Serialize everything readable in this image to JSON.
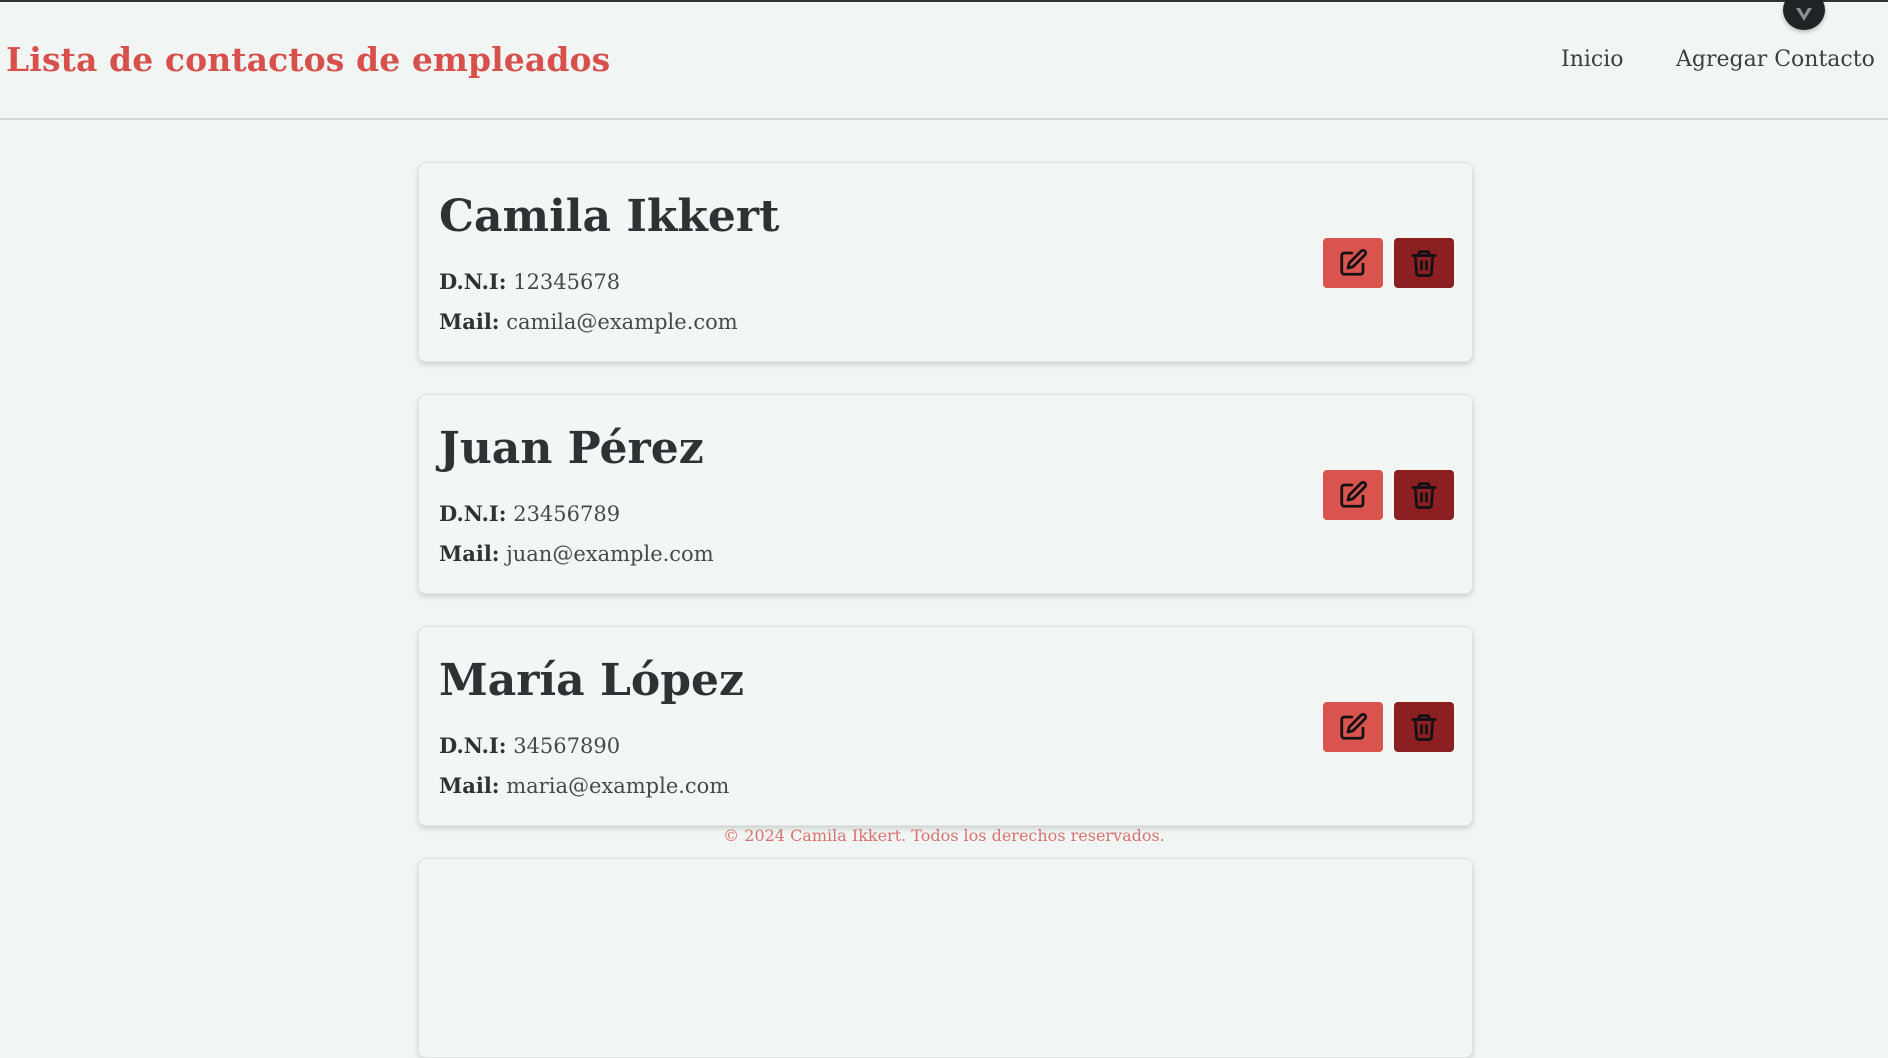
{
  "header": {
    "brand": "Lista de contactos de empleados",
    "nav": {
      "home_label": "Inicio",
      "add_contact_label": "Agregar Contacto"
    }
  },
  "field_labels": {
    "dni": "D.N.I:",
    "mail": "Mail:"
  },
  "contacts": [
    {
      "name": "Camila Ikkert",
      "dni": "12345678",
      "mail": "camila@example.com"
    },
    {
      "name": "Juan Pérez",
      "dni": "23456789",
      "mail": "juan@example.com"
    },
    {
      "name": "María López",
      "dni": "34567890",
      "mail": "maria@example.com"
    }
  ],
  "actions": {
    "edit_icon": "edit-icon",
    "delete_icon": "trash-icon"
  },
  "footer": {
    "text": "© 2024 Camila Ikkert. Todos los derechos reservados."
  },
  "colors": {
    "accent": "#d8504c",
    "edit_button": "#d9534f",
    "delete_button": "#8b1f22",
    "background": "#f1f6f4"
  }
}
